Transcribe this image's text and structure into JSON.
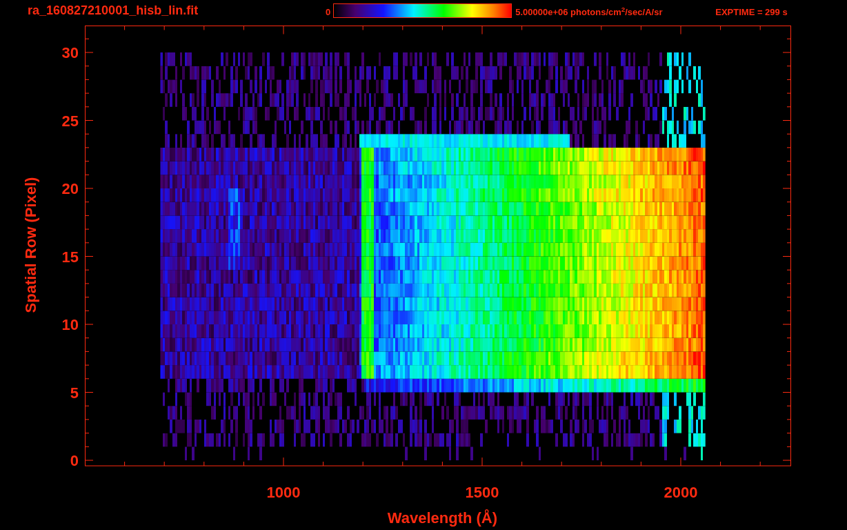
{
  "title": "ra_160827210001_hisb_lin.fit",
  "colorbar": {
    "min_label": "0",
    "max_label": "5.00000e+06 photons/cm$^{2}$/sec/A/sr"
  },
  "exposure": "EXPTIME = 299 s",
  "plot": {
    "xlabel": "Wavelength (Å)",
    "ylabel": "Spatial Row (Pixel)",
    "xticks": [
      "1000",
      "1500",
      "2000"
    ],
    "yticks": [
      "30",
      "25",
      "20",
      "15",
      "10",
      "5",
      "0"
    ]
  }
}
